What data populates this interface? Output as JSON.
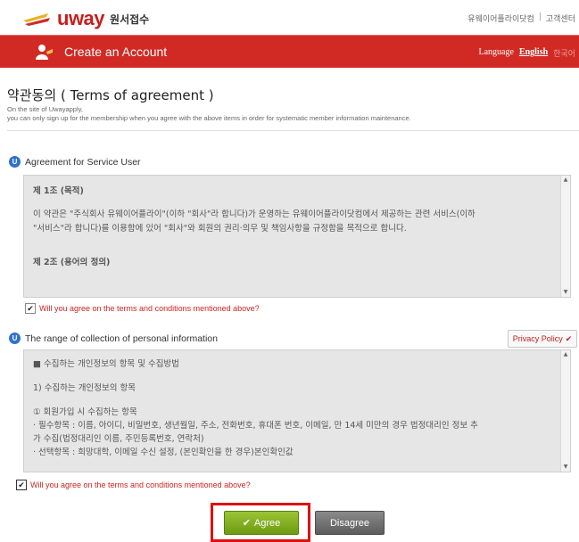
{
  "header": {
    "logo_text": "uway",
    "logo_sub": "원서접수",
    "util_links": [
      "유웨이어플라이닷컴",
      "고객센터"
    ],
    "util_separator": "|"
  },
  "banner": {
    "title": "Create an Account",
    "language_label": "Language",
    "lang_english": "English",
    "lang_korean": "한국어"
  },
  "page": {
    "title": "약관동의 ( Terms of agreement )",
    "desc_line1": "On the site of Uwayapply,",
    "desc_line2": "you can only sign up for the membership when you agree with the above items in order for systematic member information maintenance."
  },
  "section1": {
    "heading": "Agreement for Service User",
    "article1_title": "제 1조 (목적)",
    "article1_line1": "이 약관은 \"주식회사 유웨이어플라이\"(이하 \"회사\"라 합니다)가 운영하는 유웨이어플라이닷컴에서 제공하는 관련 서비스(이하",
    "article1_line2": "\"서비스\"라 합니다)를 이용함에 있어 \"회사\"와 회원의 권리·의무 및 책임사항을 규정함을 목적으로 합니다.",
    "article2_title": "제 2조 (용어의 정의)",
    "checkbox_label": "Will you agree on the terms and conditions mentioned above?",
    "checked": true
  },
  "section2": {
    "heading": "The range of collection of personal information",
    "privacy_button": "Privacy Policy",
    "line1": "■ 수집하는 개인정보의 항목 및 수집방법",
    "line2": "1) 수집하는 개인정보의 항목",
    "line3": "① 회원가입 시 수집하는 항목",
    "line4": "· 필수항목 : 이름, 아이디, 비밀번호, 생년월일, 주소, 전화번호, 휴대폰 번호, 이메일, 만 14세 미만의 경우 법정대리인 정보 추",
    "line5": "가 수집(법정대리인 이름, 주민등록번호, 연락처)",
    "line6": "· 선택항목 : 희망대학, 이메일 수신 설정, (본인확인을 한 경우)본인확인값",
    "checkbox_label": "Will you agree on the terms and conditions mentioned above?",
    "checked": true
  },
  "actions": {
    "agree": "Agree",
    "disagree": "Disagree"
  },
  "colors": {
    "brand_red": "#d12a25",
    "agree_green": "#7aa61a",
    "disagree_gray": "#666666"
  }
}
